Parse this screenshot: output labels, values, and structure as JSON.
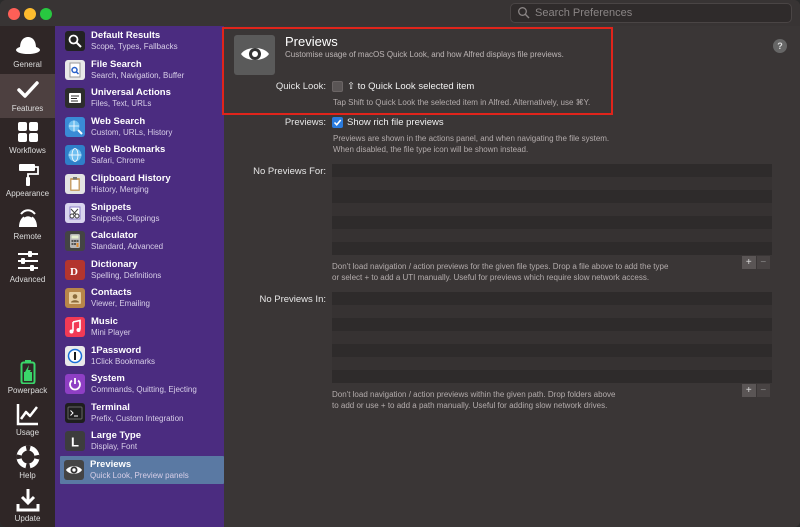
{
  "search": {
    "placeholder": "Search Preferences"
  },
  "iconbar": [
    {
      "label": "General",
      "icon": "hat-icon"
    },
    {
      "label": "Features",
      "icon": "checkmark-icon"
    },
    {
      "label": "Workflows",
      "icon": "grid-icon"
    },
    {
      "label": "Appearance",
      "icon": "paint-roller-icon"
    },
    {
      "label": "Remote",
      "icon": "remote-icon"
    },
    {
      "label": "Advanced",
      "icon": "sliders-icon"
    },
    {
      "label": "Powerpack",
      "icon": "battery-icon"
    },
    {
      "label": "Usage",
      "icon": "chart-icon"
    },
    {
      "label": "Help",
      "icon": "lifebuoy-icon"
    },
    {
      "label": "Update",
      "icon": "download-icon"
    }
  ],
  "features": [
    {
      "title": "Default Results",
      "sub": "Scope, Types, Fallbacks",
      "icon": "magnifier-icon",
      "color": "#222222",
      "glyph": ""
    },
    {
      "title": "File Search",
      "sub": "Search, Navigation, Buffer",
      "icon": "file-search-icon",
      "color": "#e8e8e8",
      "glyph": ""
    },
    {
      "title": "Universal Actions",
      "sub": "Files, Text, URLs",
      "icon": "universal-actions-icon",
      "color": "#2d2d2d",
      "glyph": ""
    },
    {
      "title": "Web Search",
      "sub": "Custom, URLs, History",
      "icon": "globe-search-icon",
      "color": "#3a8bd6",
      "glyph": ""
    },
    {
      "title": "Web Bookmarks",
      "sub": "Safari, Chrome",
      "icon": "globe-icon",
      "color": "#2f7fc9",
      "glyph": ""
    },
    {
      "title": "Clipboard History",
      "sub": "History, Merging",
      "icon": "clipboard-icon",
      "color": "#e3e3e3",
      "glyph": ""
    },
    {
      "title": "Snippets",
      "sub": "Snippets, Clippings",
      "icon": "snippets-icon",
      "color": "#d9d4ee",
      "glyph": ""
    },
    {
      "title": "Calculator",
      "sub": "Standard, Advanced",
      "icon": "calculator-icon",
      "color": "#444444",
      "glyph": ""
    },
    {
      "title": "Dictionary",
      "sub": "Spelling, Definitions",
      "icon": "dictionary-icon",
      "color": "#b3352e",
      "glyph": ""
    },
    {
      "title": "Contacts",
      "sub": "Viewer, Emailing",
      "icon": "contacts-icon",
      "color": "#b8864a",
      "glyph": ""
    },
    {
      "title": "Music",
      "sub": "Mini Player",
      "icon": "music-icon",
      "color": "#f23a55",
      "glyph": ""
    },
    {
      "title": "1Password",
      "sub": "1Click Bookmarks",
      "icon": "onepassword-icon",
      "color": "#e9e9e9",
      "glyph": ""
    },
    {
      "title": "System",
      "sub": "Commands, Quitting, Ejecting",
      "icon": "power-icon",
      "color": "#8e3fc4",
      "glyph": ""
    },
    {
      "title": "Terminal",
      "sub": "Prefix, Custom Integration",
      "icon": "terminal-icon",
      "color": "#1e1e1e",
      "glyph": ""
    },
    {
      "title": "Large Type",
      "sub": "Display, Font",
      "icon": "large-type-icon",
      "color": "#3d3d3d",
      "glyph": "L"
    },
    {
      "title": "Previews",
      "sub": "Quick Look, Preview panels",
      "icon": "eye-icon",
      "color": "#444444",
      "glyph": ""
    }
  ],
  "main": {
    "title": "Previews",
    "subtitle": "Customise usage of macOS Quick Look, and how Alfred displays file previews.",
    "quicklook": {
      "label": "Quick Look:",
      "checkbox_text": "⇧ to Quick Look selected item",
      "note": "Tap Shift to Quick Look the selected item in Alfred. Alternatively, use ⌘Y."
    },
    "previews": {
      "label": "Previews:",
      "checkbox_text": "Show rich file previews",
      "note1": "Previews are shown in the actions panel, and when navigating the file system.",
      "note2": "When disabled, the file type icon will be shown instead."
    },
    "no_previews_for": {
      "label": "No Previews For:",
      "note1": "Don't load navigation / action previews for the given file types. Drop a file above to add the type",
      "note2": "or select + to add a UTI manually. Useful for previews which require slow network access."
    },
    "no_previews_in": {
      "label": "No Previews In:",
      "note1": "Don't load navigation / action previews within the given path. Drop folders above",
      "note2": "to add or use + to add a path manually. Useful for adding slow network drives."
    },
    "plus": "+",
    "minus": "−",
    "help": "?"
  }
}
